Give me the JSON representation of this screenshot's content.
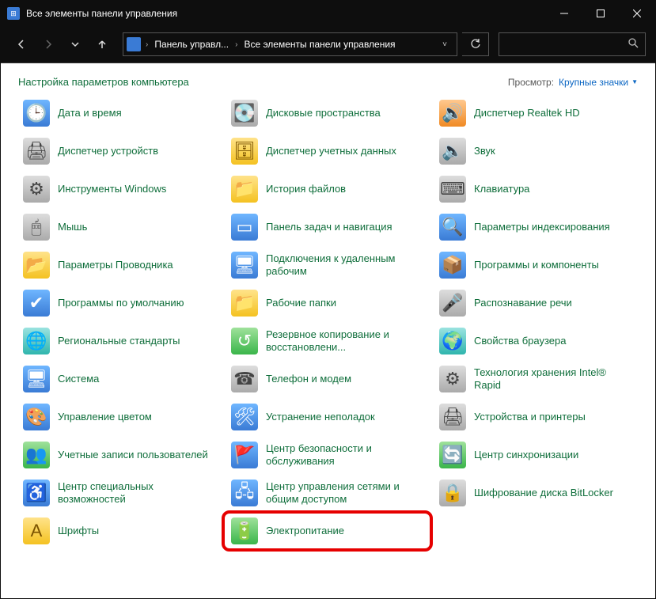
{
  "window": {
    "title": "Все элементы панели управления"
  },
  "breadcrumb": {
    "part1": "Панель управл...",
    "part2": "Все элементы панели управления"
  },
  "header": {
    "page_title": "Настройка параметров компьютера",
    "view_label": "Просмотр:",
    "view_value": "Крупные значки"
  },
  "items": [
    {
      "label": "Дата и время",
      "icon": "🕒",
      "cls": "ic-blue"
    },
    {
      "label": "Дисковые пространства",
      "icon": "💽",
      "cls": "ic-grey"
    },
    {
      "label": "Диспетчер Realtek HD",
      "icon": "🔊",
      "cls": "ic-orange"
    },
    {
      "label": "Диспетчер устройств",
      "icon": "🖨",
      "cls": "ic-grey"
    },
    {
      "label": "Диспетчер учетных данных",
      "icon": "🗄",
      "cls": "ic-yellow"
    },
    {
      "label": "Звук",
      "icon": "🔈",
      "cls": "ic-grey"
    },
    {
      "label": "Инструменты Windows",
      "icon": "⚙",
      "cls": "ic-grey"
    },
    {
      "label": "История файлов",
      "icon": "📁",
      "cls": "ic-yellow"
    },
    {
      "label": "Клавиатура",
      "icon": "⌨",
      "cls": "ic-grey"
    },
    {
      "label": "Мышь",
      "icon": "🖱",
      "cls": "ic-grey"
    },
    {
      "label": "Панель задач и навигация",
      "icon": "▭",
      "cls": "ic-blue"
    },
    {
      "label": "Параметры индексирования",
      "icon": "🔍",
      "cls": "ic-blue"
    },
    {
      "label": "Параметры Проводника",
      "icon": "📂",
      "cls": "ic-yellow"
    },
    {
      "label": "Подключения к удаленным рабочим",
      "icon": "🖥",
      "cls": "ic-blue"
    },
    {
      "label": "Программы и компоненты",
      "icon": "📦",
      "cls": "ic-blue"
    },
    {
      "label": "Программы по умолчанию",
      "icon": "✔",
      "cls": "ic-blue"
    },
    {
      "label": "Рабочие папки",
      "icon": "📁",
      "cls": "ic-yellow"
    },
    {
      "label": "Распознавание речи",
      "icon": "🎤",
      "cls": "ic-grey"
    },
    {
      "label": "Региональные стандарты",
      "icon": "🌐",
      "cls": "ic-teal"
    },
    {
      "label": "Резервное копирование и восстановлени...",
      "icon": "↺",
      "cls": "ic-green"
    },
    {
      "label": "Свойства браузера",
      "icon": "🌍",
      "cls": "ic-teal"
    },
    {
      "label": "Система",
      "icon": "🖥",
      "cls": "ic-blue"
    },
    {
      "label": "Телефон и модем",
      "icon": "☎",
      "cls": "ic-grey"
    },
    {
      "label": "Технология хранения Intel® Rapid",
      "icon": "⚙",
      "cls": "ic-grey"
    },
    {
      "label": "Управление цветом",
      "icon": "🎨",
      "cls": "ic-blue"
    },
    {
      "label": "Устранение неполадок",
      "icon": "🛠",
      "cls": "ic-blue"
    },
    {
      "label": "Устройства и принтеры",
      "icon": "🖨",
      "cls": "ic-grey"
    },
    {
      "label": "Учетные записи пользователей",
      "icon": "👥",
      "cls": "ic-green"
    },
    {
      "label": "Центр безопасности и обслуживания",
      "icon": "🚩",
      "cls": "ic-blue"
    },
    {
      "label": "Центр синхронизации",
      "icon": "🔄",
      "cls": "ic-green"
    },
    {
      "label": "Центр специальных возможностей",
      "icon": "♿",
      "cls": "ic-blue"
    },
    {
      "label": "Центр управления сетями и общим доступом",
      "icon": "🖧",
      "cls": "ic-blue"
    },
    {
      "label": "Шифрование диска BitLocker",
      "icon": "🔒",
      "cls": "ic-grey"
    },
    {
      "label": "Шрифты",
      "icon": "A",
      "cls": "ic-yellow"
    },
    {
      "label": "Электропитание",
      "icon": "🔋",
      "cls": "ic-green",
      "highlighted": true
    }
  ]
}
